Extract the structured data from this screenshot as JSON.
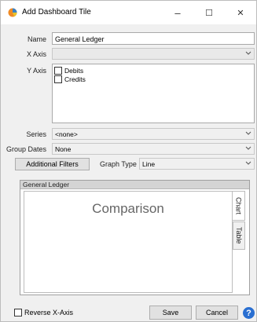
{
  "window": {
    "title": "Add Dashboard Tile",
    "controls": {
      "minimize": "–",
      "maximize": "☐",
      "close": "✕"
    }
  },
  "form": {
    "name": {
      "label": "Name",
      "value": "General Ledger"
    },
    "x_axis": {
      "label": "X Axis",
      "value": ""
    },
    "y_axis": {
      "label": "Y Axis",
      "items": [
        {
          "label": "Debits",
          "checked": false
        },
        {
          "label": "Credits",
          "checked": false
        }
      ]
    },
    "series": {
      "label": "Series",
      "value": "<none>"
    },
    "group_dates": {
      "label": "Group Dates",
      "value": "None"
    },
    "additional_filters_label": "Additional Filters",
    "graph_type": {
      "label": "Graph Type",
      "value": "Line"
    }
  },
  "preview": {
    "header": "General Ledger",
    "chart_title": "Comparison",
    "tabs": [
      "Chart",
      "Table"
    ],
    "active_tab": "Chart"
  },
  "footer": {
    "reverse_x_axis": {
      "label": "Reverse X-Axis",
      "checked": false
    },
    "save_label": "Save",
    "cancel_label": "Cancel",
    "help_label": "?"
  },
  "colors": {
    "accent": "#2a6fd1",
    "icon_orange": "#f08a24",
    "icon_blue": "#3b82c4"
  }
}
